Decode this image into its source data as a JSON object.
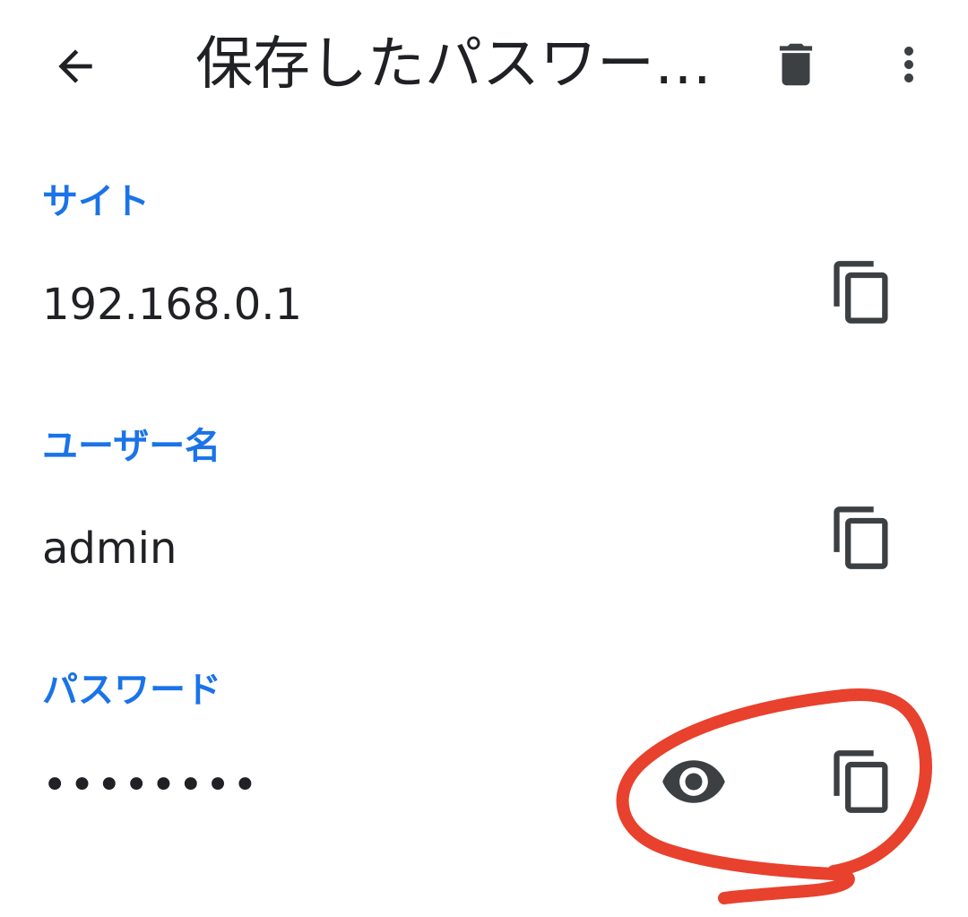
{
  "header": {
    "back_icon": "arrow-back-icon",
    "title": "保存したパスワー…",
    "delete_icon": "trash-icon",
    "more_icon": "more-vert-icon"
  },
  "fields": {
    "site": {
      "label": "サイト",
      "value": "192.168.0.1",
      "copy_icon": "copy-icon"
    },
    "username": {
      "label": "ユーザー名",
      "value": "admin",
      "copy_icon": "copy-icon"
    },
    "password": {
      "label": "パスワード",
      "value": "••••••••",
      "show_icon": "eye-icon",
      "copy_icon": "copy-icon"
    }
  },
  "colors": {
    "label_blue": "#1a73e8",
    "text": "#202124",
    "icon_gray": "#3c4043",
    "annotation_red": "#e8412d"
  }
}
